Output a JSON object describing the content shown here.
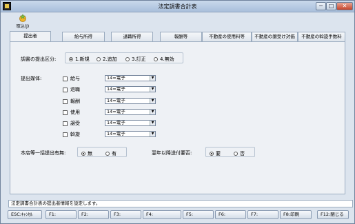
{
  "window": {
    "title": "法定調書合計表",
    "controls": {
      "minimize": "−",
      "maximize": "□",
      "close": "✕"
    },
    "accent": "#c5432a"
  },
  "toolbar": {
    "import_label": "取込(J)",
    "import_icon": "star-import-icon"
  },
  "tabs": [
    {
      "label": "提出者",
      "active": true
    },
    {
      "label": "給与所得",
      "active": false
    },
    {
      "label": "退職所得",
      "active": false
    },
    {
      "label": "報酬等",
      "active": false
    },
    {
      "label": "不動産の使用料等",
      "active": false
    },
    {
      "label": "不動産の譲受け対価",
      "active": false
    },
    {
      "label": "不動産の斡旋手数料",
      "active": false
    }
  ],
  "submission_type": {
    "label": "調書の提出区分:",
    "options": [
      "1.新規",
      "2.追加",
      "3.訂正",
      "4.無効"
    ],
    "selected": "1.新規"
  },
  "media": {
    "label": "提出媒体:",
    "items": [
      {
        "name": "給与",
        "value": "14=電子"
      },
      {
        "name": "退職",
        "value": "14=電子"
      },
      {
        "name": "報酬",
        "value": "14=電子"
      },
      {
        "name": "使用",
        "value": "14=電子"
      },
      {
        "name": "譲受",
        "value": "14=電子"
      },
      {
        "name": "斡旋",
        "value": "14=電子"
      }
    ]
  },
  "batch_submission": {
    "label": "本店等一括提出有無:",
    "options": [
      "無",
      "有"
    ],
    "selected": "無"
  },
  "next_year_form": {
    "label": "翌年以降送付要否:",
    "options": [
      "要",
      "否"
    ],
    "selected": "要"
  },
  "status_text": "法定調書合計表の提出者情報を設定します。",
  "function_keys": [
    "ESC:ｷｬﾝｾﾙ",
    "F1:",
    "F2:",
    "F3:",
    "F4:",
    "F5:",
    "F6:",
    "F7:",
    "F8:印刷",
    "F12:閉じる"
  ]
}
